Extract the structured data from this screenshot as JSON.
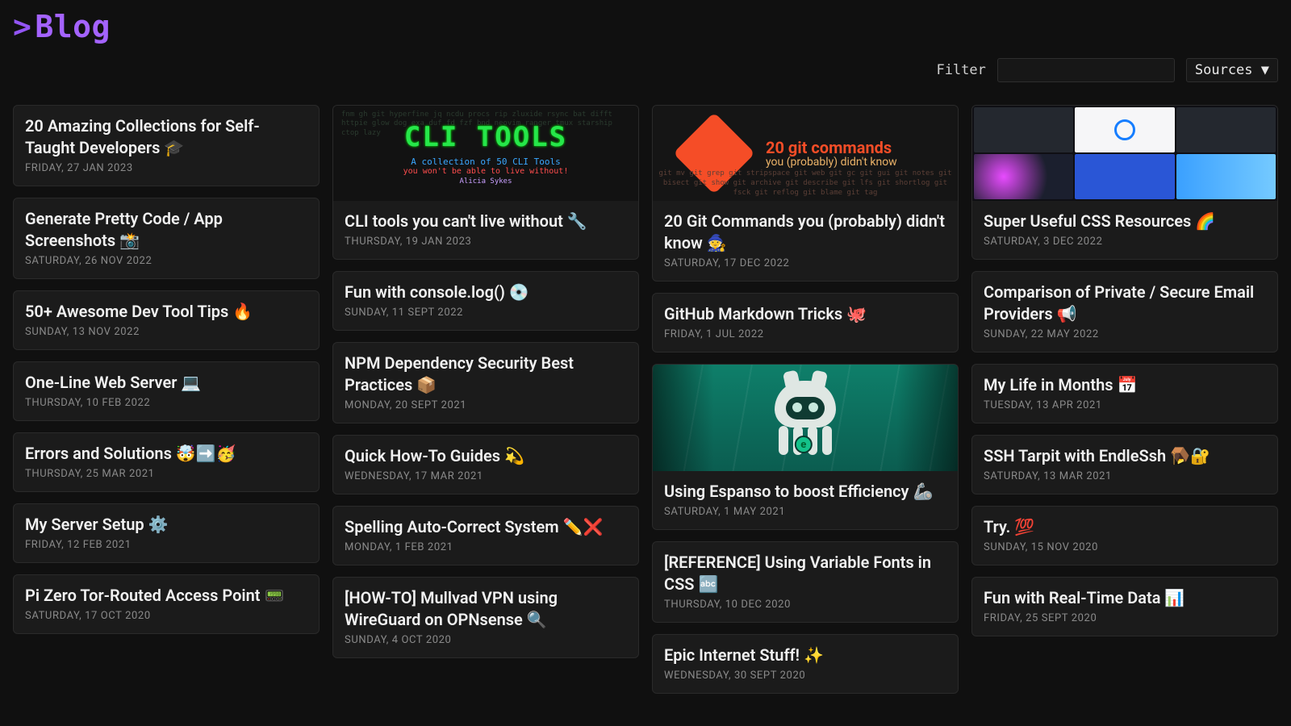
{
  "header": {
    "title_prefix": ">",
    "title": "Blog",
    "filter_label": "Filter",
    "filter_value": "",
    "sources_button": "Sources ▼"
  },
  "columns": [
    [
      {
        "type": "plain",
        "title": "20 Amazing Collections for Self-Taught Developers 🎓",
        "date": "FRIDAY, 27 JAN 2023"
      },
      {
        "type": "plain",
        "title": "Generate Pretty Code / App Screenshots 📸",
        "date": "SATURDAY, 26 NOV 2022"
      },
      {
        "type": "plain",
        "title": "50+ Awesome Dev Tool Tips 🔥",
        "date": "SUNDAY, 13 NOV 2022"
      },
      {
        "type": "plain",
        "title": "One-Line Web Server 💻",
        "date": "THURSDAY, 10 FEB 2022"
      },
      {
        "type": "plain",
        "title": "Errors and Solutions 🤯➡️🥳",
        "date": "THURSDAY, 25 MAR 2021"
      },
      {
        "type": "plain",
        "title": "My Server Setup ⚙️",
        "date": "FRIDAY, 12 FEB 2021"
      },
      {
        "type": "plain",
        "title": "Pi Zero Tor-Routed Access Point 📟",
        "date": "SATURDAY, 17 OCT 2020"
      }
    ],
    [
      {
        "type": "thumb-cli",
        "title": "CLI tools you can't live without 🔧",
        "date": "THURSDAY, 19 JAN 2023",
        "thumb": {
          "big": "CLI TOOLS",
          "sub1": "A collection of 50 CLI Tools",
          "sub2": "you won't be able to live without!",
          "sub3": "Alicia Sykes",
          "bg": "fnm gh git hyperfine jq ncdu procs rip zluxide rsync bat difft httpie glow dog exa duf fd fzf bnd neovim ranger tmux starship ctop lazy"
        }
      },
      {
        "type": "plain",
        "title": "Fun with console.log() 💿",
        "date": "SUNDAY, 11 SEPT 2022"
      },
      {
        "type": "plain",
        "title": "NPM Dependency Security Best Practices 📦",
        "date": "MONDAY, 20 SEPT 2021"
      },
      {
        "type": "plain",
        "title": "Quick How-To Guides 💫",
        "date": "WEDNESDAY, 17 MAR 2021"
      },
      {
        "type": "plain",
        "title": "Spelling Auto-Correct System ✏️❌",
        "date": "MONDAY, 1 FEB 2021"
      },
      {
        "type": "plain",
        "title": "[HOW-TO] Mullvad VPN using WireGuard on OPNsense 🔍",
        "date": "SUNDAY, 4 OCT 2020"
      }
    ],
    [
      {
        "type": "thumb-git",
        "title": "20 Git Commands you (probably) didn't know 🧙",
        "date": "SATURDAY, 17 DEC 2022",
        "thumb": {
          "t1": "20 git commands",
          "t2": "you (probably) didn't know",
          "cmds": "git mv   git grep   git stripspace   git web   git gc\ngit gui   git notes   git bisect\ngit show   git archive   git describe   git lfs\ngit shortlog   git fsck   git reflog   git blame   git tag"
        }
      },
      {
        "type": "plain",
        "title": "GitHub Markdown Tricks 🐙",
        "date": "FRIDAY, 1 JUL 2022"
      },
      {
        "type": "thumb-esp",
        "title": "Using Espanso to boost Efficiency 🦾",
        "date": "SATURDAY, 1 MAY 2021",
        "thumb": {
          "badge": "e"
        }
      },
      {
        "type": "plain",
        "title": "[REFERENCE] Using Variable Fonts in CSS 🔤",
        "date": "THURSDAY, 10 DEC 2020"
      },
      {
        "type": "plain",
        "title": "Epic Internet Stuff! ✨",
        "date": "WEDNESDAY, 30 SEPT 2020"
      }
    ],
    [
      {
        "type": "thumb-css",
        "title": "Super Useful CSS Resources 🌈",
        "date": "SATURDAY, 3 DEC 2022"
      },
      {
        "type": "plain",
        "title": "Comparison of Private / Secure Email Providers 📢",
        "date": "SUNDAY, 22 MAY 2022"
      },
      {
        "type": "plain",
        "title": "My Life in Months 📅",
        "date": "TUESDAY, 13 APR 2021"
      },
      {
        "type": "plain",
        "title": "SSH Tarpit with EndleSsh 🪤🔐",
        "date": "SATURDAY, 13 MAR 2021"
      },
      {
        "type": "plain",
        "title": "Try. 💯",
        "date": "SUNDAY, 15 NOV 2020"
      },
      {
        "type": "plain",
        "title": "Fun with Real-Time Data 📊",
        "date": "FRIDAY, 25 SEPT 2020"
      }
    ]
  ]
}
